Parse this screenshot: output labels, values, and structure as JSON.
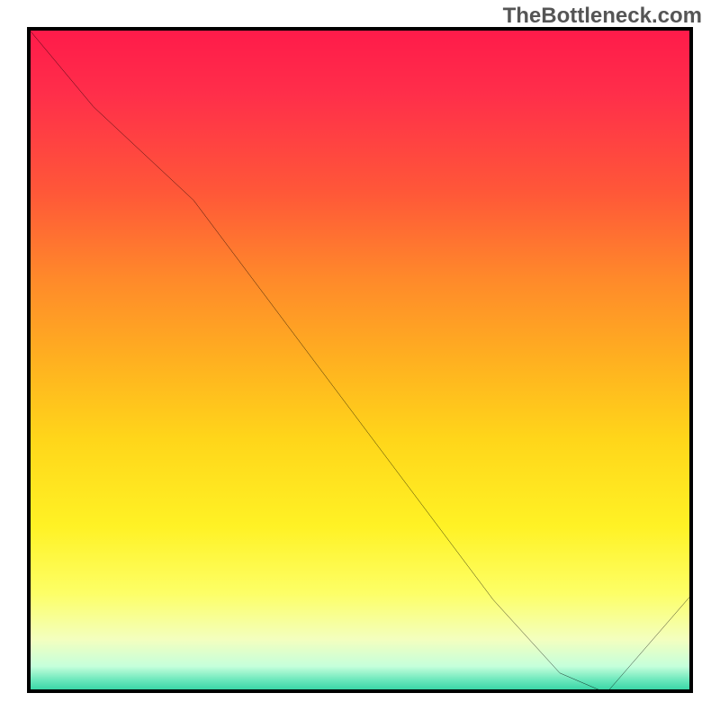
{
  "watermark": "TheBottleneck.com",
  "chart_data": {
    "type": "line",
    "title": "",
    "xlabel": "",
    "ylabel": "",
    "xlim": [
      0,
      100
    ],
    "ylim": [
      0,
      100
    ],
    "x": [
      0,
      10,
      25,
      40,
      55,
      70,
      80,
      87,
      100
    ],
    "values": [
      100,
      88,
      74,
      54,
      34,
      14,
      3,
      0,
      15
    ],
    "background_gradient": {
      "top": "#ff1a4a",
      "mid": "#ffd61a",
      "bottom": "#28d09f"
    },
    "x_labels": [
      {
        "pos": 80,
        "label": ""
      }
    ]
  }
}
